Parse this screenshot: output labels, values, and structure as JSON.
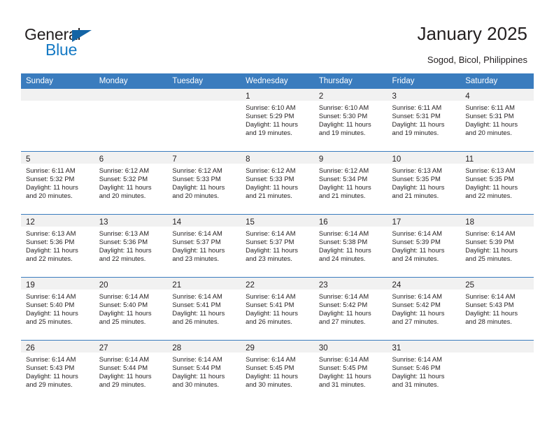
{
  "brand": {
    "name_part1": "General",
    "name_part2": "Blue",
    "accent_color": "#1479c4",
    "triangle_color": "#1464a5"
  },
  "header": {
    "title": "January 2025",
    "subtitle": "Sogod, Bicol, Philippines"
  },
  "calendar": {
    "header_bg": "#3a7cbe",
    "daynum_band_bg": "#f1f1f1",
    "weekdays": [
      "Sunday",
      "Monday",
      "Tuesday",
      "Wednesday",
      "Thursday",
      "Friday",
      "Saturday"
    ],
    "weeks": [
      [
        {
          "day": "",
          "empty": true
        },
        {
          "day": "",
          "empty": true
        },
        {
          "day": "",
          "empty": true
        },
        {
          "day": "1",
          "sunrise": "Sunrise: 6:10 AM",
          "sunset": "Sunset: 5:29 PM",
          "daylight1": "Daylight: 11 hours",
          "daylight2": "and 19 minutes."
        },
        {
          "day": "2",
          "sunrise": "Sunrise: 6:10 AM",
          "sunset": "Sunset: 5:30 PM",
          "daylight1": "Daylight: 11 hours",
          "daylight2": "and 19 minutes."
        },
        {
          "day": "3",
          "sunrise": "Sunrise: 6:11 AM",
          "sunset": "Sunset: 5:31 PM",
          "daylight1": "Daylight: 11 hours",
          "daylight2": "and 19 minutes."
        },
        {
          "day": "4",
          "sunrise": "Sunrise: 6:11 AM",
          "sunset": "Sunset: 5:31 PM",
          "daylight1": "Daylight: 11 hours",
          "daylight2": "and 20 minutes."
        }
      ],
      [
        {
          "day": "5",
          "sunrise": "Sunrise: 6:11 AM",
          "sunset": "Sunset: 5:32 PM",
          "daylight1": "Daylight: 11 hours",
          "daylight2": "and 20 minutes."
        },
        {
          "day": "6",
          "sunrise": "Sunrise: 6:12 AM",
          "sunset": "Sunset: 5:32 PM",
          "daylight1": "Daylight: 11 hours",
          "daylight2": "and 20 minutes."
        },
        {
          "day": "7",
          "sunrise": "Sunrise: 6:12 AM",
          "sunset": "Sunset: 5:33 PM",
          "daylight1": "Daylight: 11 hours",
          "daylight2": "and 20 minutes."
        },
        {
          "day": "8",
          "sunrise": "Sunrise: 6:12 AM",
          "sunset": "Sunset: 5:33 PM",
          "daylight1": "Daylight: 11 hours",
          "daylight2": "and 21 minutes."
        },
        {
          "day": "9",
          "sunrise": "Sunrise: 6:12 AM",
          "sunset": "Sunset: 5:34 PM",
          "daylight1": "Daylight: 11 hours",
          "daylight2": "and 21 minutes."
        },
        {
          "day": "10",
          "sunrise": "Sunrise: 6:13 AM",
          "sunset": "Sunset: 5:35 PM",
          "daylight1": "Daylight: 11 hours",
          "daylight2": "and 21 minutes."
        },
        {
          "day": "11",
          "sunrise": "Sunrise: 6:13 AM",
          "sunset": "Sunset: 5:35 PM",
          "daylight1": "Daylight: 11 hours",
          "daylight2": "and 22 minutes."
        }
      ],
      [
        {
          "day": "12",
          "sunrise": "Sunrise: 6:13 AM",
          "sunset": "Sunset: 5:36 PM",
          "daylight1": "Daylight: 11 hours",
          "daylight2": "and 22 minutes."
        },
        {
          "day": "13",
          "sunrise": "Sunrise: 6:13 AM",
          "sunset": "Sunset: 5:36 PM",
          "daylight1": "Daylight: 11 hours",
          "daylight2": "and 22 minutes."
        },
        {
          "day": "14",
          "sunrise": "Sunrise: 6:14 AM",
          "sunset": "Sunset: 5:37 PM",
          "daylight1": "Daylight: 11 hours",
          "daylight2": "and 23 minutes."
        },
        {
          "day": "15",
          "sunrise": "Sunrise: 6:14 AM",
          "sunset": "Sunset: 5:37 PM",
          "daylight1": "Daylight: 11 hours",
          "daylight2": "and 23 minutes."
        },
        {
          "day": "16",
          "sunrise": "Sunrise: 6:14 AM",
          "sunset": "Sunset: 5:38 PM",
          "daylight1": "Daylight: 11 hours",
          "daylight2": "and 24 minutes."
        },
        {
          "day": "17",
          "sunrise": "Sunrise: 6:14 AM",
          "sunset": "Sunset: 5:39 PM",
          "daylight1": "Daylight: 11 hours",
          "daylight2": "and 24 minutes."
        },
        {
          "day": "18",
          "sunrise": "Sunrise: 6:14 AM",
          "sunset": "Sunset: 5:39 PM",
          "daylight1": "Daylight: 11 hours",
          "daylight2": "and 25 minutes."
        }
      ],
      [
        {
          "day": "19",
          "sunrise": "Sunrise: 6:14 AM",
          "sunset": "Sunset: 5:40 PM",
          "daylight1": "Daylight: 11 hours",
          "daylight2": "and 25 minutes."
        },
        {
          "day": "20",
          "sunrise": "Sunrise: 6:14 AM",
          "sunset": "Sunset: 5:40 PM",
          "daylight1": "Daylight: 11 hours",
          "daylight2": "and 25 minutes."
        },
        {
          "day": "21",
          "sunrise": "Sunrise: 6:14 AM",
          "sunset": "Sunset: 5:41 PM",
          "daylight1": "Daylight: 11 hours",
          "daylight2": "and 26 minutes."
        },
        {
          "day": "22",
          "sunrise": "Sunrise: 6:14 AM",
          "sunset": "Sunset: 5:41 PM",
          "daylight1": "Daylight: 11 hours",
          "daylight2": "and 26 minutes."
        },
        {
          "day": "23",
          "sunrise": "Sunrise: 6:14 AM",
          "sunset": "Sunset: 5:42 PM",
          "daylight1": "Daylight: 11 hours",
          "daylight2": "and 27 minutes."
        },
        {
          "day": "24",
          "sunrise": "Sunrise: 6:14 AM",
          "sunset": "Sunset: 5:42 PM",
          "daylight1": "Daylight: 11 hours",
          "daylight2": "and 27 minutes."
        },
        {
          "day": "25",
          "sunrise": "Sunrise: 6:14 AM",
          "sunset": "Sunset: 5:43 PM",
          "daylight1": "Daylight: 11 hours",
          "daylight2": "and 28 minutes."
        }
      ],
      [
        {
          "day": "26",
          "sunrise": "Sunrise: 6:14 AM",
          "sunset": "Sunset: 5:43 PM",
          "daylight1": "Daylight: 11 hours",
          "daylight2": "and 29 minutes."
        },
        {
          "day": "27",
          "sunrise": "Sunrise: 6:14 AM",
          "sunset": "Sunset: 5:44 PM",
          "daylight1": "Daylight: 11 hours",
          "daylight2": "and 29 minutes."
        },
        {
          "day": "28",
          "sunrise": "Sunrise: 6:14 AM",
          "sunset": "Sunset: 5:44 PM",
          "daylight1": "Daylight: 11 hours",
          "daylight2": "and 30 minutes."
        },
        {
          "day": "29",
          "sunrise": "Sunrise: 6:14 AM",
          "sunset": "Sunset: 5:45 PM",
          "daylight1": "Daylight: 11 hours",
          "daylight2": "and 30 minutes."
        },
        {
          "day": "30",
          "sunrise": "Sunrise: 6:14 AM",
          "sunset": "Sunset: 5:45 PM",
          "daylight1": "Daylight: 11 hours",
          "daylight2": "and 31 minutes."
        },
        {
          "day": "31",
          "sunrise": "Sunrise: 6:14 AM",
          "sunset": "Sunset: 5:46 PM",
          "daylight1": "Daylight: 11 hours",
          "daylight2": "and 31 minutes."
        },
        {
          "day": "",
          "empty": true
        }
      ]
    ]
  }
}
